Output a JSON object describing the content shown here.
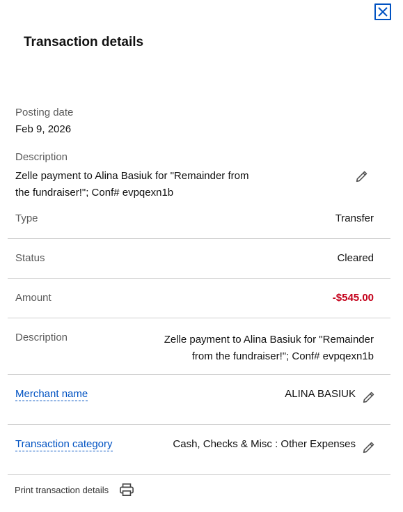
{
  "header": {
    "title": "Transaction details"
  },
  "posting": {
    "label": "Posting date",
    "value": "Feb 9, 2026"
  },
  "top_description": {
    "label": "Description",
    "line1": "Zelle payment to Alina Basiuk for \"Remainder from",
    "line2": "the fundraiser!\"; Conf# evpqexn1b"
  },
  "rows": {
    "type": {
      "label": "Type",
      "value": "Transfer"
    },
    "status": {
      "label": "Status",
      "value": "Cleared"
    },
    "amount": {
      "label": "Amount",
      "value": "-$545.00"
    },
    "description": {
      "label": "Description",
      "line1": "Zelle payment to Alina Basiuk for \"Remainder",
      "line2": "from the fundraiser!\"; Conf# evpqexn1b"
    },
    "merchant": {
      "label": "Merchant name",
      "value": "ALINA BASIUK"
    },
    "category": {
      "label": "Transaction category",
      "value": "Cash, Checks & Misc : Other Expenses"
    }
  },
  "footer": {
    "print_label": "Print transaction details"
  },
  "colors": {
    "accent": "#0052c2",
    "negative": "#c4001a",
    "divider": "#cfcfcf"
  },
  "icons": [
    "close-icon",
    "pencil-icon",
    "printer-icon"
  ]
}
